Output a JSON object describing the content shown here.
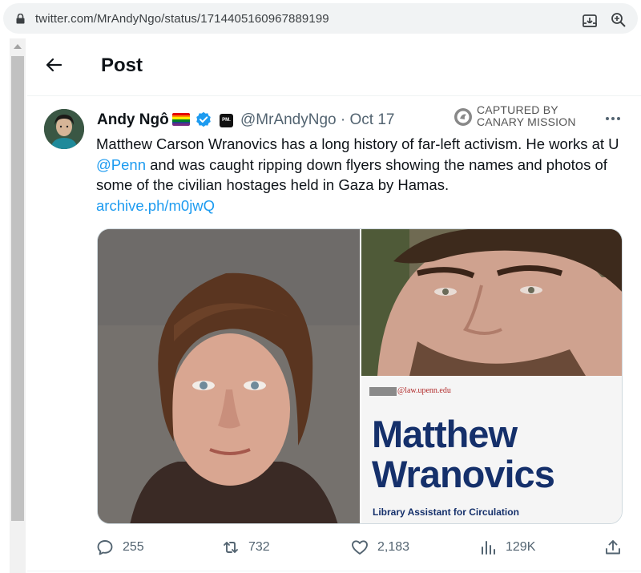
{
  "browser": {
    "url": "twitter.com/MrAndyNgo/status/1714405160967889199",
    "icons": [
      "lock-icon",
      "download-icon",
      "zoom-icon"
    ]
  },
  "header": {
    "title": "Post",
    "back_icon": "back-arrow-icon"
  },
  "tweet": {
    "author_name": "Andy Ngô",
    "handle_line": "@MrAndyNgo · Oct 17",
    "affiliate_badge": "PM.",
    "badges": [
      "rainbow-flag-icon",
      "verified-icon",
      "affiliate-icon"
    ],
    "verified_color": "#1d9bf0",
    "text_part1": "Matthew Carson Wranovics has a long history of far-left activism. He works at U ",
    "mention": "@Penn",
    "text_part2": " and was caught ripping down flyers showing the names and photos of some of the civilian hostages held in Gaza by Hamas.",
    "link": "archive.ph/m0jwQ",
    "link_color": "#1d9bf0"
  },
  "overlay": {
    "captured_line1": "CAPTURED BY",
    "captured_line2": "CANARY MISSION"
  },
  "media": {
    "card_email": "@law.upenn.edu",
    "card_name_line1": "Matthew",
    "card_name_line2": "Wranovics",
    "card_role": "Library Assistant for Circulation",
    "card_text_color": "#15306b"
  },
  "actions": {
    "replies": "255",
    "reposts": "732",
    "likes": "2,183",
    "views": "129K"
  }
}
